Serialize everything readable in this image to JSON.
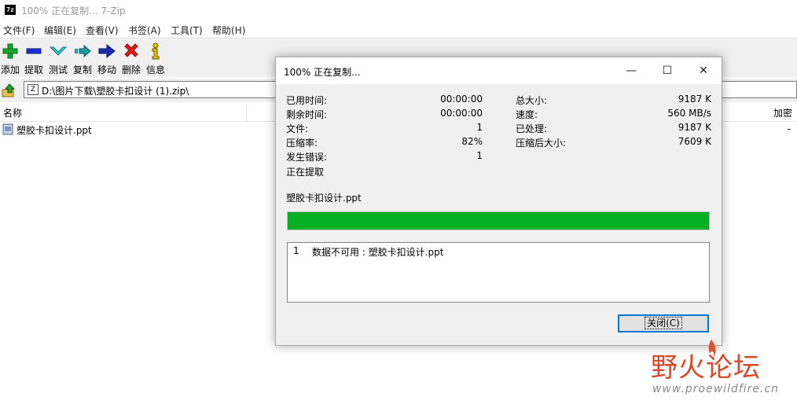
{
  "window": {
    "title": "100% 正在复制... 7-Zip",
    "icon_text": "7z"
  },
  "menu": [
    "文件(F)",
    "编辑(E)",
    "查看(V)",
    "书签(A)",
    "工具(T)",
    "帮助(H)"
  ],
  "toolbar": [
    {
      "label": "添加",
      "icon": "plus-icon"
    },
    {
      "label": "提取",
      "icon": "minus-icon"
    },
    {
      "label": "测试",
      "icon": "check-chevron-icon"
    },
    {
      "label": "复制",
      "icon": "copy-arrow-icon"
    },
    {
      "label": "移动",
      "icon": "move-arrow-icon"
    },
    {
      "label": "删除",
      "icon": "delete-x-icon"
    },
    {
      "label": "信息",
      "icon": "info-icon"
    }
  ],
  "address": {
    "path": "D:\\图片下载\\塑胶卡扣设计 (1).zip\\"
  },
  "list": {
    "columns": {
      "name": "名称",
      "encrypted": "加密"
    },
    "rows": [
      {
        "name": "塑胶卡扣设计.ppt",
        "encrypted": "-"
      }
    ]
  },
  "dialog": {
    "title": "100% 正在复制...",
    "left_stats": [
      {
        "label": "已用时间:",
        "value": "00:00:00"
      },
      {
        "label": "剩余时间:",
        "value": "00:00:00"
      },
      {
        "label": "文件:",
        "value": "1"
      },
      {
        "label": "压缩率:",
        "value": "82%"
      },
      {
        "label": "发生错误:",
        "value": "1"
      }
    ],
    "right_stats": [
      {
        "label": "总大小:",
        "value": "9187 K"
      },
      {
        "label": "速度:",
        "value": "560 MB/s"
      },
      {
        "label": "已处理:",
        "value": "9187 K"
      },
      {
        "label": "压缩后大小:",
        "value": "7609 K"
      }
    ],
    "status": "正在提取",
    "current_file": "塑胶卡扣设计.ppt",
    "progress": 1.0,
    "progress_color": "#06b025",
    "messages": [
      {
        "num": "1",
        "text": "数据不可用 : 塑胶卡扣设计.ppt"
      }
    ],
    "close_label": "关闭(C)",
    "buttons": {
      "minimize": "—",
      "maximize": "☐",
      "close": "✕"
    }
  },
  "watermark": {
    "logo": "野火论坛",
    "url": "www.proewildfire.cn"
  }
}
